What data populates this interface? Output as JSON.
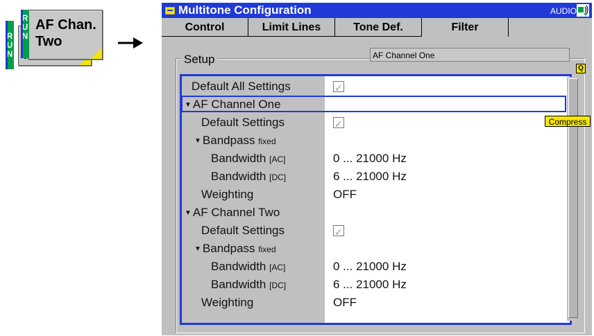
{
  "softkey": {
    "run_letters": [
      "R",
      "U",
      "N"
    ],
    "front_line1": "AF Chan.",
    "front_line2": "Two",
    "back_line": "Two"
  },
  "window": {
    "title": "Multitone Configuration",
    "audio_label": "AUDIO"
  },
  "tabs": [
    {
      "label": "Control",
      "active": false
    },
    {
      "label": "Limit Lines",
      "active": false
    },
    {
      "label": "Tone Def.",
      "active": false
    },
    {
      "label": "Filter",
      "active": true
    }
  ],
  "setup": {
    "label": "Setup",
    "header_value": "AF Channel One",
    "compress_label": "Compress",
    "q_label": "Q"
  },
  "rows": [
    {
      "label": "Default All Settings",
      "value": "",
      "check": true
    },
    {
      "label": "AF Channel One",
      "value": "",
      "check": false,
      "expand": true
    },
    {
      "label": "Default Settings",
      "value": "",
      "check": true
    },
    {
      "label": "Bandpass",
      "suffix": "fixed",
      "value": "",
      "check": false,
      "expand": true
    },
    {
      "label": "Bandwidth",
      "suffix": "[AC]",
      "value": "0 ... 21000 Hz",
      "check": false
    },
    {
      "label": "Bandwidth",
      "suffix": "[DC]",
      "value": "6 ... 21000 Hz",
      "check": false
    },
    {
      "label": "Weighting",
      "value": "OFF",
      "check": false
    },
    {
      "label": "AF Channel Two",
      "value": "",
      "check": false,
      "expand": true
    },
    {
      "label": "Default Settings",
      "value": "",
      "check": true
    },
    {
      "label": "Bandpass",
      "suffix": "fixed",
      "value": "",
      "check": false,
      "expand": true
    },
    {
      "label": "Bandwidth",
      "suffix": "[AC]",
      "value": "0 ... 21000 Hz",
      "check": false
    },
    {
      "label": "Bandwidth",
      "suffix": "[DC]",
      "value": "6 ... 21000 Hz",
      "check": false
    },
    {
      "label": "Weighting",
      "value": "OFF",
      "check": false
    }
  ],
  "colors": {
    "accent": "#1f3ad6",
    "run_green": "#00a04a",
    "highlight_yellow": "#f4e600",
    "panel_gray": "#c0c0c0"
  }
}
